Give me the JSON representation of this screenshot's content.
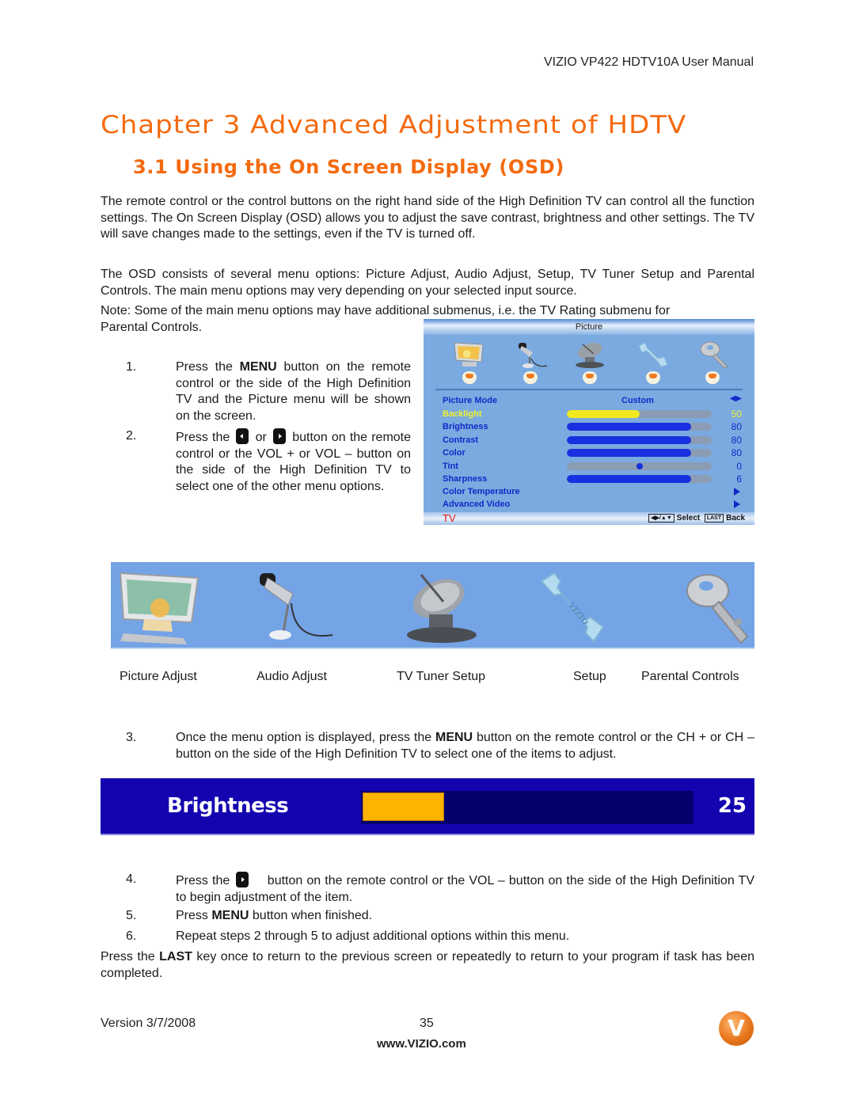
{
  "header": {
    "manual_title": "VIZIO VP422 HDTV10A User Manual"
  },
  "chapter": {
    "title": "Chapter 3 Advanced Adjustment of HDTV"
  },
  "section": {
    "title": "3.1 Using the On Screen Display (OSD)"
  },
  "paragraphs": {
    "intro": "The remote control or the control buttons on the right hand side of the High Definition TV can control all the function settings.  The On Screen Display (OSD) allows you to adjust the save contrast, brightness and other settings.  The TV will save changes made to the settings, even if the TV is turned off.",
    "menu_options": "The OSD consists of several menu options: Picture Adjust, Audio Adjust, Setup, TV Tuner Setup and Parental Controls.  The main menu options may very depending on your selected input source.",
    "note_part1": "Note:  Some of the main menu options may have additional submenus, i.e. the TV Rating submenu for",
    "note_part2": "Parental Controls.",
    "closing": "Press the LAST key once to return to the previous screen or repeatedly to return to your program if task has been completed."
  },
  "steps": [
    {
      "num": "1.",
      "pre": "Press the ",
      "bold": "MENU",
      "post": " button on the remote control or the side of the High Definition TV and the Picture menu will be shown on the screen."
    },
    {
      "num": "2.",
      "pre": "Press the",
      "mid": "or",
      "post": "button on the remote control or the VOL + or VOL – button on the side of the High Definition TV to select one of the other menu options."
    },
    {
      "num": "3.",
      "pre": "Once the menu option is displayed, press the ",
      "bold": "MENU",
      "post": " button on the remote control or the CH + or CH – button on the side of the High Definition TV to select one of the items to adjust."
    },
    {
      "num": "4.",
      "pre": "Press the",
      "post": "button on the remote control or the VOL – button on the side of the High Definition TV to begin adjustment of the item."
    },
    {
      "num": "5.",
      "pre": "Press ",
      "bold": "MENU",
      "post": " button when finished."
    },
    {
      "num": "6.",
      "pre": "Repeat steps 2 through 5 to adjust additional options within this menu."
    }
  ],
  "closing_parts": {
    "pre": "Press the ",
    "bold": "LAST",
    "post": " key once to return to the previous screen or repeatedly to return to your program if task has been completed."
  },
  "osd_menu": {
    "title": "Picture",
    "icons": [
      "monitor-icon",
      "microphone-icon",
      "satellite-dish-icon",
      "wrench-icon",
      "key-icon"
    ],
    "mode_label": "Picture Mode",
    "mode_value": "Custom",
    "rows": [
      {
        "label": "Backlight",
        "value": "50",
        "level": 0.5,
        "selected": true
      },
      {
        "label": "Brightness",
        "value": "80",
        "level": 0.86
      },
      {
        "label": "Contrast",
        "value": "80",
        "level": 0.86
      },
      {
        "label": "Color",
        "value": "80",
        "level": 0.86
      },
      {
        "label": "Tint",
        "value": "0",
        "level": 0.5,
        "type": "dot"
      },
      {
        "label": "Sharpness",
        "value": "6",
        "level": 0.86
      }
    ],
    "submenus": [
      "Color Temperature",
      "Advanced Video"
    ],
    "source": "TV",
    "help_keys": "◀▶/▲▼",
    "help_select": "Select",
    "help_last_key": "LAST",
    "help_back": "Back"
  },
  "main_menu": {
    "items": [
      {
        "label": "Picture Adjust",
        "icon": "monitor-icon"
      },
      {
        "label": "Audio Adjust",
        "icon": "microphone-icon"
      },
      {
        "label": "TV Tuner Setup",
        "icon": "satellite-dish-icon"
      },
      {
        "label": "Setup",
        "icon": "wrench-icon"
      },
      {
        "label": "Parental Controls",
        "icon": "key-icon"
      }
    ]
  },
  "brightness_bar": {
    "label": "Brightness",
    "value": "25",
    "level": 0.25,
    "fill_color": "#fbb400"
  },
  "footer": {
    "version": "Version 3/7/2008",
    "page": "35",
    "url": "www.VIZIO.com",
    "logo_letter": "V"
  },
  "colors": {
    "heading": "#f46a0f",
    "osd_text": "#1428c8",
    "osd_selected": "#f0f030",
    "brightness_bg": "#1404b0"
  }
}
